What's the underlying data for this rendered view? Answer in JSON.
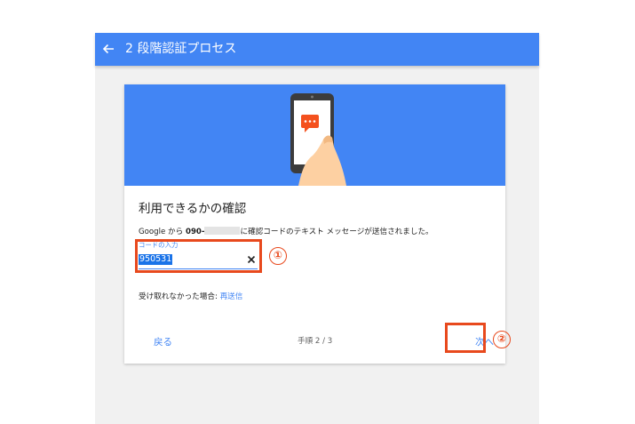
{
  "appbar": {
    "title": "2 段階認証プロセス",
    "back_icon": "arrow-back-icon"
  },
  "card": {
    "title": "利用できるかの確認",
    "message_prefix": "Google から ",
    "message_phone": "090-",
    "message_suffix": "に確認コードのテキスト メッセージが送信されました。",
    "code_field": {
      "label": "コードの入力",
      "value": "950531",
      "clear_icon": "close-icon"
    },
    "resend_prompt": "受け取れなかった場合: ",
    "resend_link": "再送信",
    "back_label": "戻る",
    "step_text": "手順 2 / 3",
    "next_label": "次へ"
  },
  "annotations": {
    "marker_1": "①",
    "marker_2": "②",
    "color": "#e8491d"
  },
  "colors": {
    "brand_blue": "#4285f4",
    "background": "#f1f1f1"
  }
}
